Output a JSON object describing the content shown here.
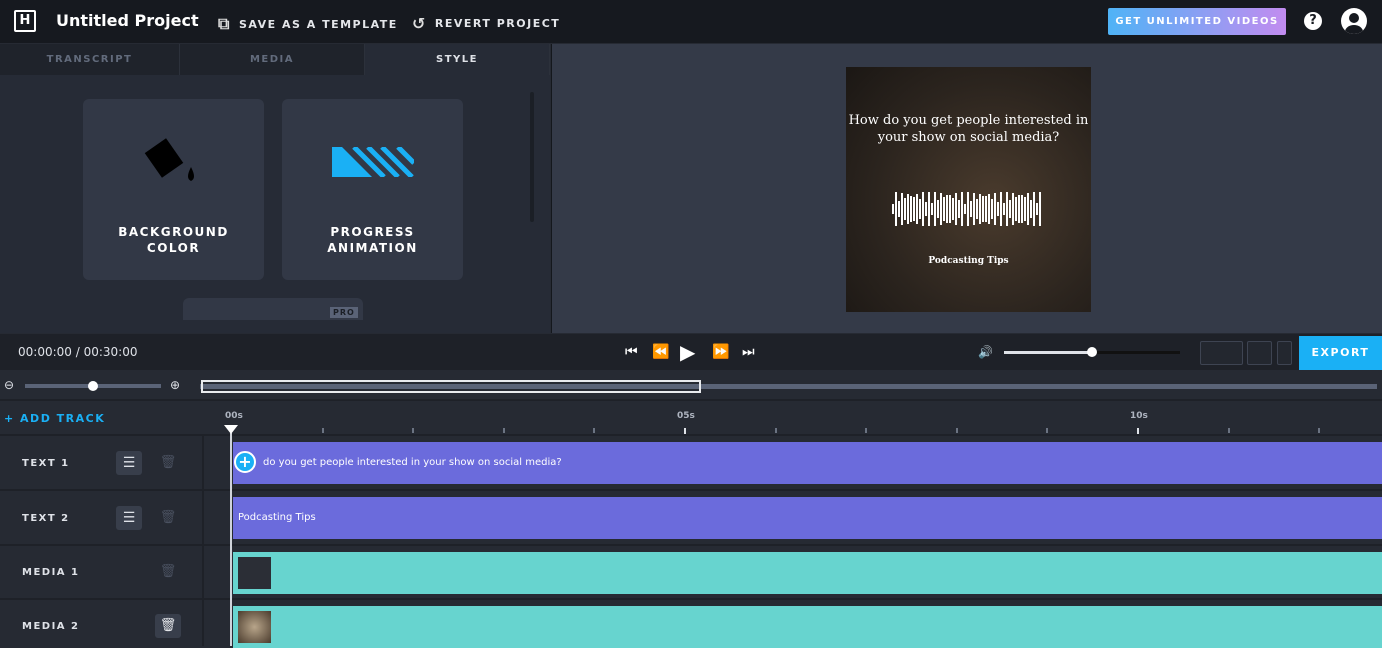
{
  "header": {
    "title": "Untitled Project",
    "save_template": "SAVE AS A TEMPLATE",
    "revert": "REVERT PROJECT",
    "unlimited": "GET UNLIMITED VIDEOS",
    "help": "?"
  },
  "tabs": [
    {
      "label": "TRANSCRIPT"
    },
    {
      "label": "MEDIA"
    },
    {
      "label": "STYLE",
      "active": true
    }
  ],
  "style_cards": [
    {
      "label1": "BACKGROUND",
      "label2": "COLOR",
      "icon": "paint-bucket-icon"
    },
    {
      "label1": "PROGRESS",
      "label2": "ANIMATION",
      "icon": "progress-stripes-icon"
    }
  ],
  "pro_badge": "PRO",
  "preview": {
    "headline": "How do you get people interested in your show on social media?",
    "subtitle": "Podcasting Tips"
  },
  "controls": {
    "time": "00:00:00 / 00:30:00",
    "volume_percent": 50,
    "export": "EXPORT"
  },
  "timeline": {
    "add_track": "+ ADD TRACK",
    "ruler": [
      "00s",
      "05s",
      "10s"
    ],
    "zoom_level_percent": 50
  },
  "tracks": [
    {
      "label": "TEXT 1",
      "clip": "do you get people interested in your show on social media?",
      "type": "text"
    },
    {
      "label": "TEXT 2",
      "clip": "Podcasting Tips",
      "type": "text"
    },
    {
      "label": "MEDIA 1",
      "type": "media"
    },
    {
      "label": "MEDIA 2",
      "type": "media"
    }
  ],
  "colors": {
    "accent": "#1ab0f5",
    "text_clip": "#6b6bdc",
    "media_clip": "#67d4cf"
  }
}
